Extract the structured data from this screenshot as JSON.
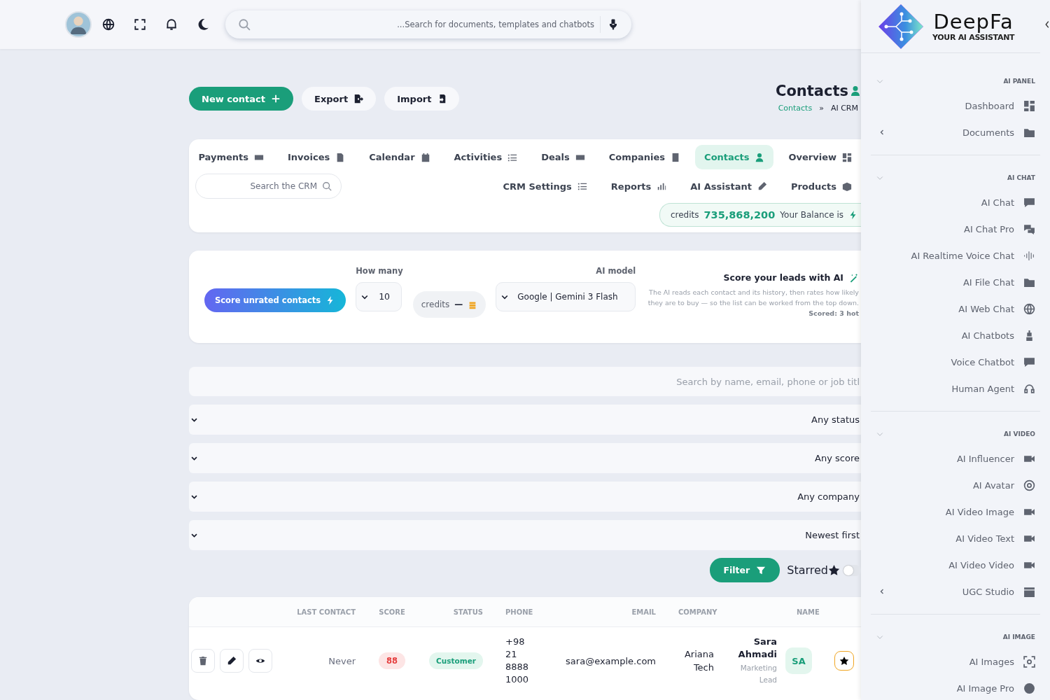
{
  "topbar": {
    "search": {
      "placeholder": "...Search for documents, templates and chatbots"
    }
  },
  "actions": [
    {
      "label": "New contact",
      "kind": "primary"
    },
    {
      "label": "Export",
      "kind": "export"
    },
    {
      "label": "Import",
      "kind": "import"
    }
  ],
  "page_header": {
    "title": "Contacts",
    "breadcrumbs": [
      {
        "label": "Contacts",
        "kind": "link"
      },
      {
        "label": "»",
        "kind": "separator"
      },
      {
        "label": "AI CRM",
        "kind": "current"
      }
    ]
  },
  "nav": {
    "tabs": [
      {
        "label": "Payments",
        "selected": false
      },
      {
        "label": "Invoices",
        "selected": false
      },
      {
        "label": "Calendar",
        "selected": false
      },
      {
        "label": "Activities",
        "selected": false
      },
      {
        "label": "Deals",
        "selected": false
      },
      {
        "label": "Companies",
        "selected": false
      },
      {
        "label": "Contacts",
        "selected": true
      },
      {
        "label": "Overview",
        "selected": false
      }
    ],
    "search": {
      "placeholder": "Search the CRM"
    },
    "links": [
      "CRM Settings",
      "Reports",
      "AI Assistant",
      "Products"
    ],
    "balance": {
      "label": "credits",
      "amount": "735,868,200",
      "caption": "Your Balance is"
    }
  },
  "scoring": {
    "button": "Score unrated contacts",
    "how_many": {
      "label": "How many",
      "value": "10"
    },
    "cost": {
      "label": "credits",
      "value": "—"
    },
    "model": {
      "label": "AI model",
      "value": "Google | Gemini 3 Flash"
    },
    "title": "Score your leads with AI",
    "description": "The AI reads each contact and its history, then rates how likely they are to buy — so the list can be worked from the top down. **Scored: 3 hot**"
  },
  "filters": {
    "search": {
      "placeholder": "Search by name, email, phone or job titl"
    },
    "selects": [
      "Any status",
      "Any score",
      "Any company",
      "Newest first"
    ],
    "filter_button": "Filter",
    "starred": {
      "label": "Starred",
      "on": false
    }
  },
  "table": {
    "columns": [
      "LAST CONTACT",
      "SCORE",
      "STATUS",
      "PHONE",
      "EMAIL",
      "COMPANY",
      "NAME"
    ],
    "rows": [
      {
        "last_contact": "Never",
        "score": "88",
        "status": "Customer",
        "phone": "+98 21 8888 1000",
        "email": "sara@example.com",
        "company": "Ariana Tech",
        "name": "Sara Ahmadi",
        "job_title": "Marketing Lead",
        "initials": "SA",
        "starred": true
      }
    ]
  },
  "sidebar": {
    "brand": {
      "name": "DeepFa",
      "tagline": "YOUR AI ASSISTANT"
    },
    "sections": [
      {
        "title": "AI PANEL",
        "expanded": true,
        "items": [
          {
            "label": "Dashboard",
            "has_children": false
          },
          {
            "label": "Documents",
            "has_children": true
          }
        ]
      },
      {
        "title": "AI CHAT",
        "expanded": true,
        "items": [
          {
            "label": "AI Chat",
            "has_children": false
          },
          {
            "label": "AI Chat Pro",
            "has_children": false
          },
          {
            "label": "AI Realtime Voice Chat",
            "has_children": false
          },
          {
            "label": "AI File Chat",
            "has_children": false
          },
          {
            "label": "AI Web Chat",
            "has_children": false
          },
          {
            "label": "AI Chatbots",
            "has_children": false
          },
          {
            "label": "Voice Chatbot",
            "has_children": false
          },
          {
            "label": "Human Agent",
            "has_children": false
          }
        ]
      },
      {
        "title": "AI VIDEO",
        "expanded": true,
        "items": [
          {
            "label": "AI Influencer",
            "has_children": false
          },
          {
            "label": "AI Avatar",
            "has_children": false
          },
          {
            "label": "AI Video Image",
            "has_children": false
          },
          {
            "label": "AI Video Text",
            "has_children": false
          },
          {
            "label": "AI Video Video",
            "has_children": false
          },
          {
            "label": "UGC Studio",
            "has_children": true
          }
        ]
      },
      {
        "title": "AI IMAGE",
        "expanded": true,
        "items": [
          {
            "label": "AI Images",
            "has_children": false
          },
          {
            "label": "AI Image Pro",
            "has_children": false
          }
        ]
      }
    ]
  }
}
